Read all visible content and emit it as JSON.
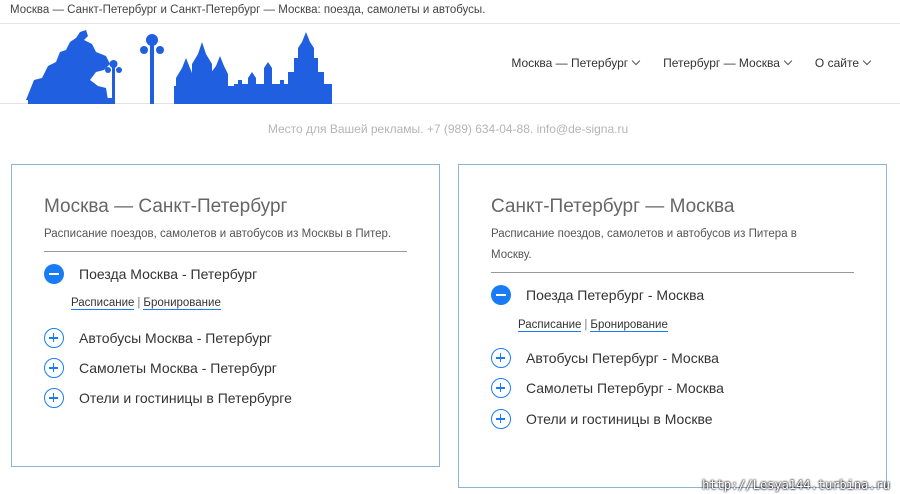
{
  "topline": {
    "text": "Москва — Санкт-Петербург и Санкт-Петербург — Москва: поезда, самолеты и автобусы."
  },
  "nav": {
    "items": [
      {
        "label": "Москва — Петербург"
      },
      {
        "label": "Петербург — Москва"
      },
      {
        "label": "О сайте"
      }
    ]
  },
  "ad": {
    "text": "Место для Вашей рекламы. +7 (989) 634-04-88. info@de-signa.ru"
  },
  "cards": [
    {
      "title": "Москва — Санкт-Петербург",
      "description": "Расписание поездов, самолетов и автобусов из Москвы в Питер.",
      "open_item": "Поезда Москва - Петербург",
      "sublinks": [
        "Расписание",
        "Бронирование"
      ],
      "separator": "|",
      "items": [
        "Автобусы Москва - Петербург",
        "Самолеты Москва - Петербург",
        "Отели и гостиницы в Петербурге"
      ]
    },
    {
      "title": "Санкт-Петербург — Москва",
      "description": "Расписание поездов, самолетов и автобусов из Питера в Москву.",
      "open_item": "Поезда Петербург - Москва",
      "sublinks": [
        "Расписание",
        "Бронирование"
      ],
      "separator": "|",
      "items": [
        "Автобусы Петербург - Москва",
        "Самолеты Петербург - Москва",
        "Отели и гостиницы в Москве"
      ]
    }
  ],
  "watermark": "http://Lesya144.turbina.ru",
  "colors": {
    "accent": "#1a7cf5",
    "logo": "#1f5fe0",
    "card_border": "#8fb2d8"
  }
}
